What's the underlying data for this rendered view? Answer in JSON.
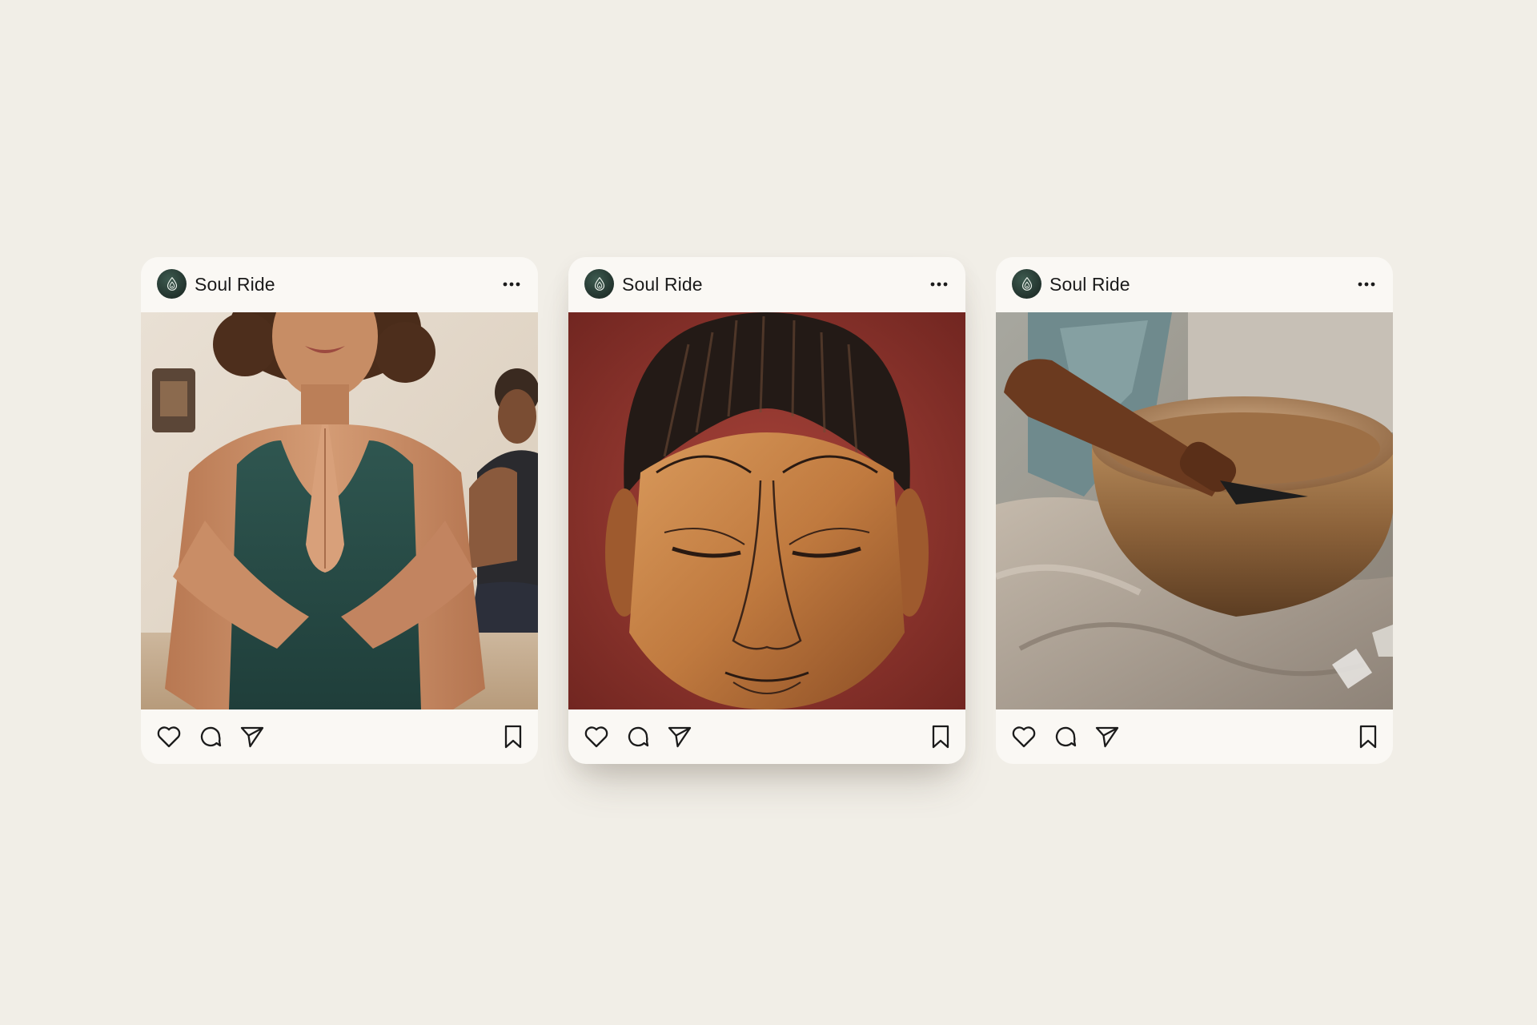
{
  "posts": [
    {
      "account": {
        "name": "Soul Ride",
        "avatar_icon": "soul-ride-logo-icon"
      },
      "menu_icon": "more-horizontal-icon",
      "image": {
        "subject": "woman-yoga-prayer-hands"
      },
      "actions": [
        "heart-icon",
        "comment-icon",
        "send-icon",
        "bookmark-icon"
      ]
    },
    {
      "account": {
        "name": "Soul Ride",
        "avatar_icon": "soul-ride-logo-icon"
      },
      "menu_icon": "more-horizontal-icon",
      "image": {
        "subject": "buddha-face-painting"
      },
      "actions": [
        "heart-icon",
        "comment-icon",
        "send-icon",
        "bookmark-icon"
      ]
    },
    {
      "account": {
        "name": "Soul Ride",
        "avatar_icon": "soul-ride-logo-icon"
      },
      "menu_icon": "more-horizontal-icon",
      "image": {
        "subject": "singing-bowl-with-mallet"
      },
      "actions": [
        "heart-icon",
        "comment-icon",
        "send-icon",
        "bookmark-icon"
      ]
    }
  ],
  "colors": {
    "background": "#f1eee7",
    "card": "#faf8f4",
    "avatar": "#22332d",
    "text": "#1b1b1b"
  }
}
